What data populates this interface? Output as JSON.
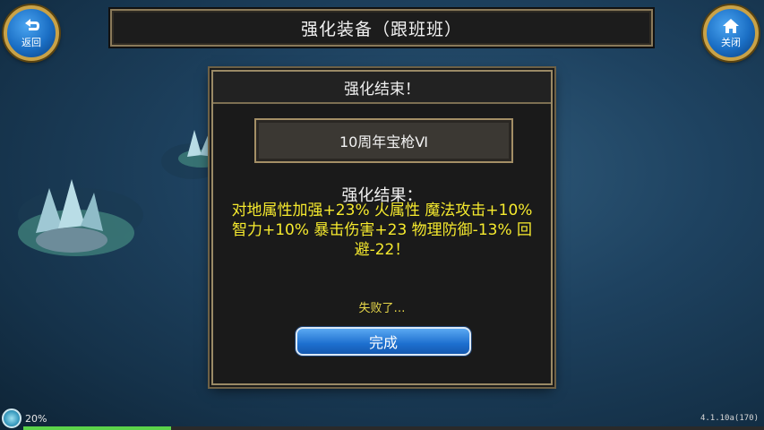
{
  "header": {
    "title": "强化装备（跟班班）",
    "back_label": "返回",
    "close_label": "关闭"
  },
  "dialog": {
    "title": "强化结束！",
    "item_name": "10周年宝枪Ⅵ",
    "result_title": "强化结果：",
    "result_text": "对地属性加强+23% 火属性 魔法攻击+10% 智力+10% 暴击伤害+23 物理防御-13% 回避-22！",
    "status_text": "失败了…",
    "done_label": "完成"
  },
  "status_bar": {
    "progress_text": "20%",
    "progress_value": 0.2,
    "version": "4.1.10a(170)"
  },
  "colors": {
    "result_yellow": "#f6ea2e",
    "button_blue": "#1d6fcf",
    "frame_gold": "#c9a247"
  },
  "icons": {
    "back": "return-arrow-icon",
    "close": "house-icon"
  }
}
